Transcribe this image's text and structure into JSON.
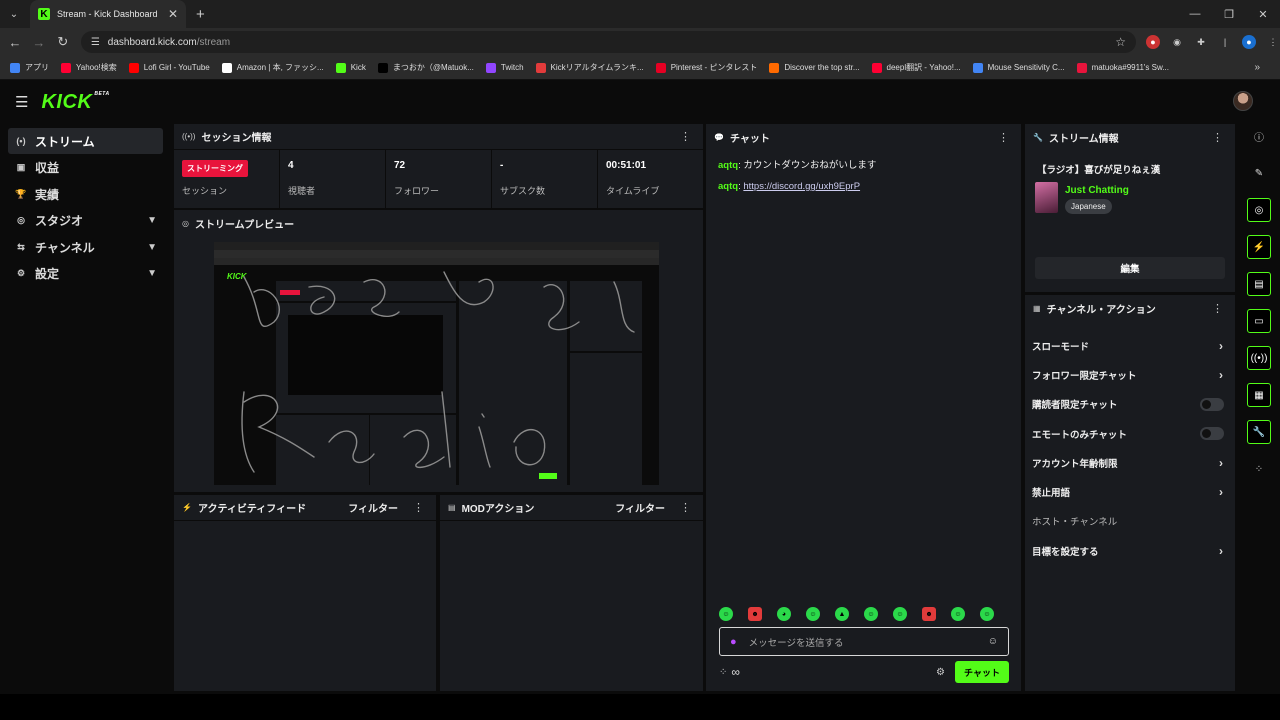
{
  "browser": {
    "tab_title": "Stream - Kick Dashboard",
    "url_host": "dashboard.kick.com",
    "url_path": "/stream",
    "bookmarks": [
      {
        "label": "アプリ",
        "color": "#4285f4"
      },
      {
        "label": "Yahoo!検索",
        "color": "#ff0033"
      },
      {
        "label": "Lofi Girl - YouTube",
        "color": "#ff0000"
      },
      {
        "label": "Amazon | 本, ファッシ...",
        "color": "#ffffff"
      },
      {
        "label": "Kick",
        "color": "#53fc18"
      },
      {
        "label": "まつおか（@Matuok...",
        "color": "#000000"
      },
      {
        "label": "Twitch",
        "color": "#9146ff"
      },
      {
        "label": "Kickリアルタイムランキ...",
        "color": "#e23b3b"
      },
      {
        "label": "Pinterest - ピンタレスト",
        "color": "#e60023"
      },
      {
        "label": "Discover the top str...",
        "color": "#ff6a00"
      },
      {
        "label": "deepl翻訳 - Yahoo!...",
        "color": "#ff0033"
      },
      {
        "label": "Mouse Sensitivity C...",
        "color": "#4285f4"
      },
      {
        "label": "matuoka#9911's Sw...",
        "color": "#e8143c"
      }
    ]
  },
  "sidebar": {
    "items": [
      {
        "label": "ストリーム",
        "icon": "(•)"
      },
      {
        "label": "収益",
        "icon": "▣"
      },
      {
        "label": "実績",
        "icon": "🏆"
      },
      {
        "label": "スタジオ",
        "icon": "◎"
      },
      {
        "label": "チャンネル",
        "icon": "⇆"
      },
      {
        "label": "設定",
        "icon": "⚙"
      }
    ]
  },
  "session": {
    "title": "セッション情報",
    "badge": "ストリーミング",
    "stats": [
      {
        "value": "",
        "label": "セッション"
      },
      {
        "value": "4",
        "label": "視聴者"
      },
      {
        "value": "72",
        "label": "フォロワー"
      },
      {
        "value": "-",
        "label": "サブスク数"
      },
      {
        "value": "00:51:01",
        "label": "タイムライブ"
      }
    ]
  },
  "preview": {
    "title": "ストリームプレビュー"
  },
  "activity": {
    "title": "アクティビティフィード",
    "filter": "フィルター"
  },
  "mod": {
    "title": "MODアクション",
    "filter": "フィルター"
  },
  "chat": {
    "title": "チャット",
    "messages": [
      {
        "user": "aqtq",
        "text": "カウントダウンおねがいします",
        "link": ""
      },
      {
        "user": "aqtq",
        "text": "",
        "link": "https://discord.gg/uxh9EprP"
      }
    ],
    "placeholder": "メッセージを送信する",
    "send_label": "チャット",
    "infinity": "∞"
  },
  "stream_info": {
    "title": "ストリーム情報",
    "stream_title": "【ラジオ】喜びが足りねぇ漢",
    "category": "Just Chatting",
    "language": "Japanese",
    "edit_label": "編集"
  },
  "channel_actions": {
    "title": "チャンネル・アクション",
    "items": [
      {
        "label": "スローモード",
        "control": "chevron"
      },
      {
        "label": "フォロワー限定チャット",
        "control": "chevron"
      },
      {
        "label": "購読者限定チャット",
        "control": "toggle"
      },
      {
        "label": "エモートのみチャット",
        "control": "toggle"
      },
      {
        "label": "アカウント年齢制限",
        "control": "chevron"
      },
      {
        "label": "禁止用語",
        "control": "chevron"
      },
      {
        "label": "ホスト・チャンネル",
        "control": "none"
      },
      {
        "label": "目標を設定する",
        "control": "chevron"
      }
    ]
  },
  "colors": {
    "accent": "#53fc18",
    "live": "#e8143c",
    "panel": "#191b1f"
  }
}
